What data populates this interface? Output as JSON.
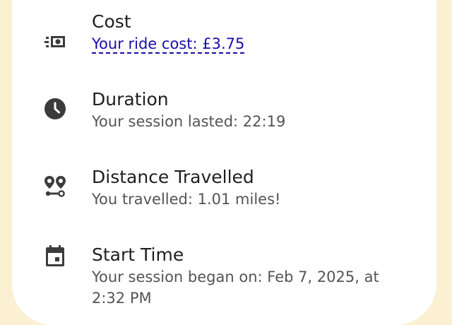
{
  "rows": {
    "cost": {
      "icon": "cash-icon",
      "title": "Cost",
      "value": "Your ride cost: £3.75"
    },
    "duration": {
      "icon": "clock-icon",
      "title": "Duration",
      "value": "Your session lasted: 22:19"
    },
    "distance": {
      "icon": "route-pins-icon",
      "title": "Distance Travelled",
      "value": "You travelled: 1.01 miles!"
    },
    "start": {
      "icon": "calendar-icon",
      "title": "Start Time",
      "value_line1": "Your session began on: Feb 7, 2025, at",
      "value_line2": "2:32 PM"
    }
  },
  "colors": {
    "background": "#FBF0D2",
    "card": "#FFFFFF",
    "title_text": "#1F1F1F",
    "secondary_text": "#545454",
    "link": "#1A0DAB",
    "icon": "#3C3C3C"
  }
}
